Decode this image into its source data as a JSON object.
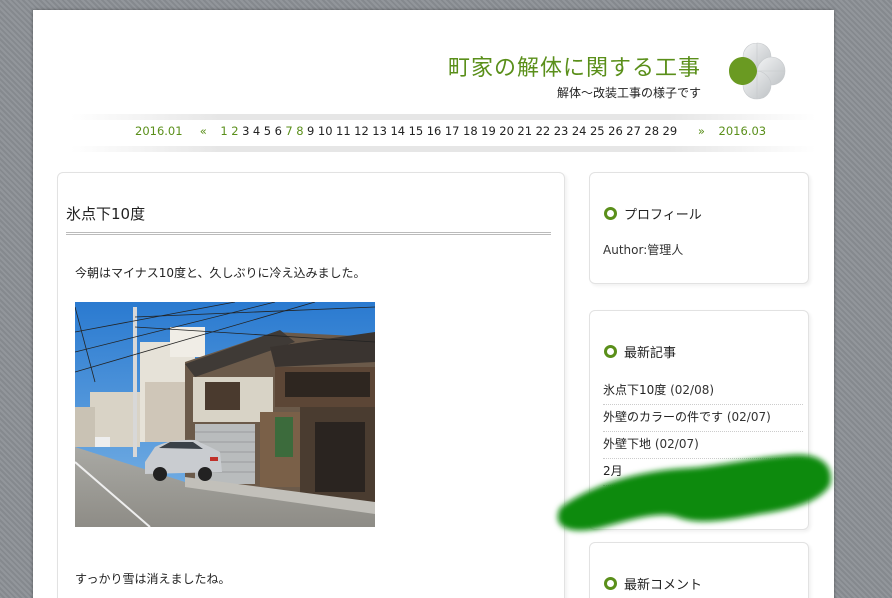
{
  "header": {
    "site_title": "町家の解体に関する工事",
    "site_description": "解体～改装工事の様子です",
    "logo_icon": "four-leaf-logo-icon"
  },
  "calendar_nav": {
    "prev_month": "2016.01",
    "prev_arrow": "«",
    "days": [
      "1",
      "2",
      "3",
      "4",
      "5",
      "6",
      "7",
      "8",
      "9",
      "10",
      "11",
      "12",
      "13",
      "14",
      "15",
      "16",
      "17",
      "18",
      "19",
      "20",
      "21",
      "22",
      "23",
      "24",
      "25",
      "26",
      "27",
      "28",
      "29"
    ],
    "linked_days": [
      "1",
      "2",
      "7",
      "8"
    ],
    "next_arrow": "»",
    "next_month": "2016.03"
  },
  "post": {
    "title": "氷点下10度",
    "paragraph1": "今朝はマイナス10度と、久しぶりに冷え込みました。",
    "paragraph2": "すっかり雪は消えましたね。",
    "photo_alt": "street-photo"
  },
  "sidebar": {
    "profile": {
      "title": "プロフィール",
      "author": "Author:管理人"
    },
    "recent": {
      "title": "最新記事",
      "items": [
        {
          "title": "氷点下10度",
          "date": "(02/08)"
        },
        {
          "title": "外壁のカラーの件です",
          "date": "(02/07)"
        },
        {
          "title": "外壁下地",
          "date": "(02/07)"
        },
        {
          "title": "2月",
          "date": ""
        }
      ]
    },
    "comments": {
      "title": "最新コメント"
    }
  },
  "colors": {
    "accent": "#5a8f1a",
    "scribble": "#0a8a0a",
    "background": "#8c9096"
  }
}
